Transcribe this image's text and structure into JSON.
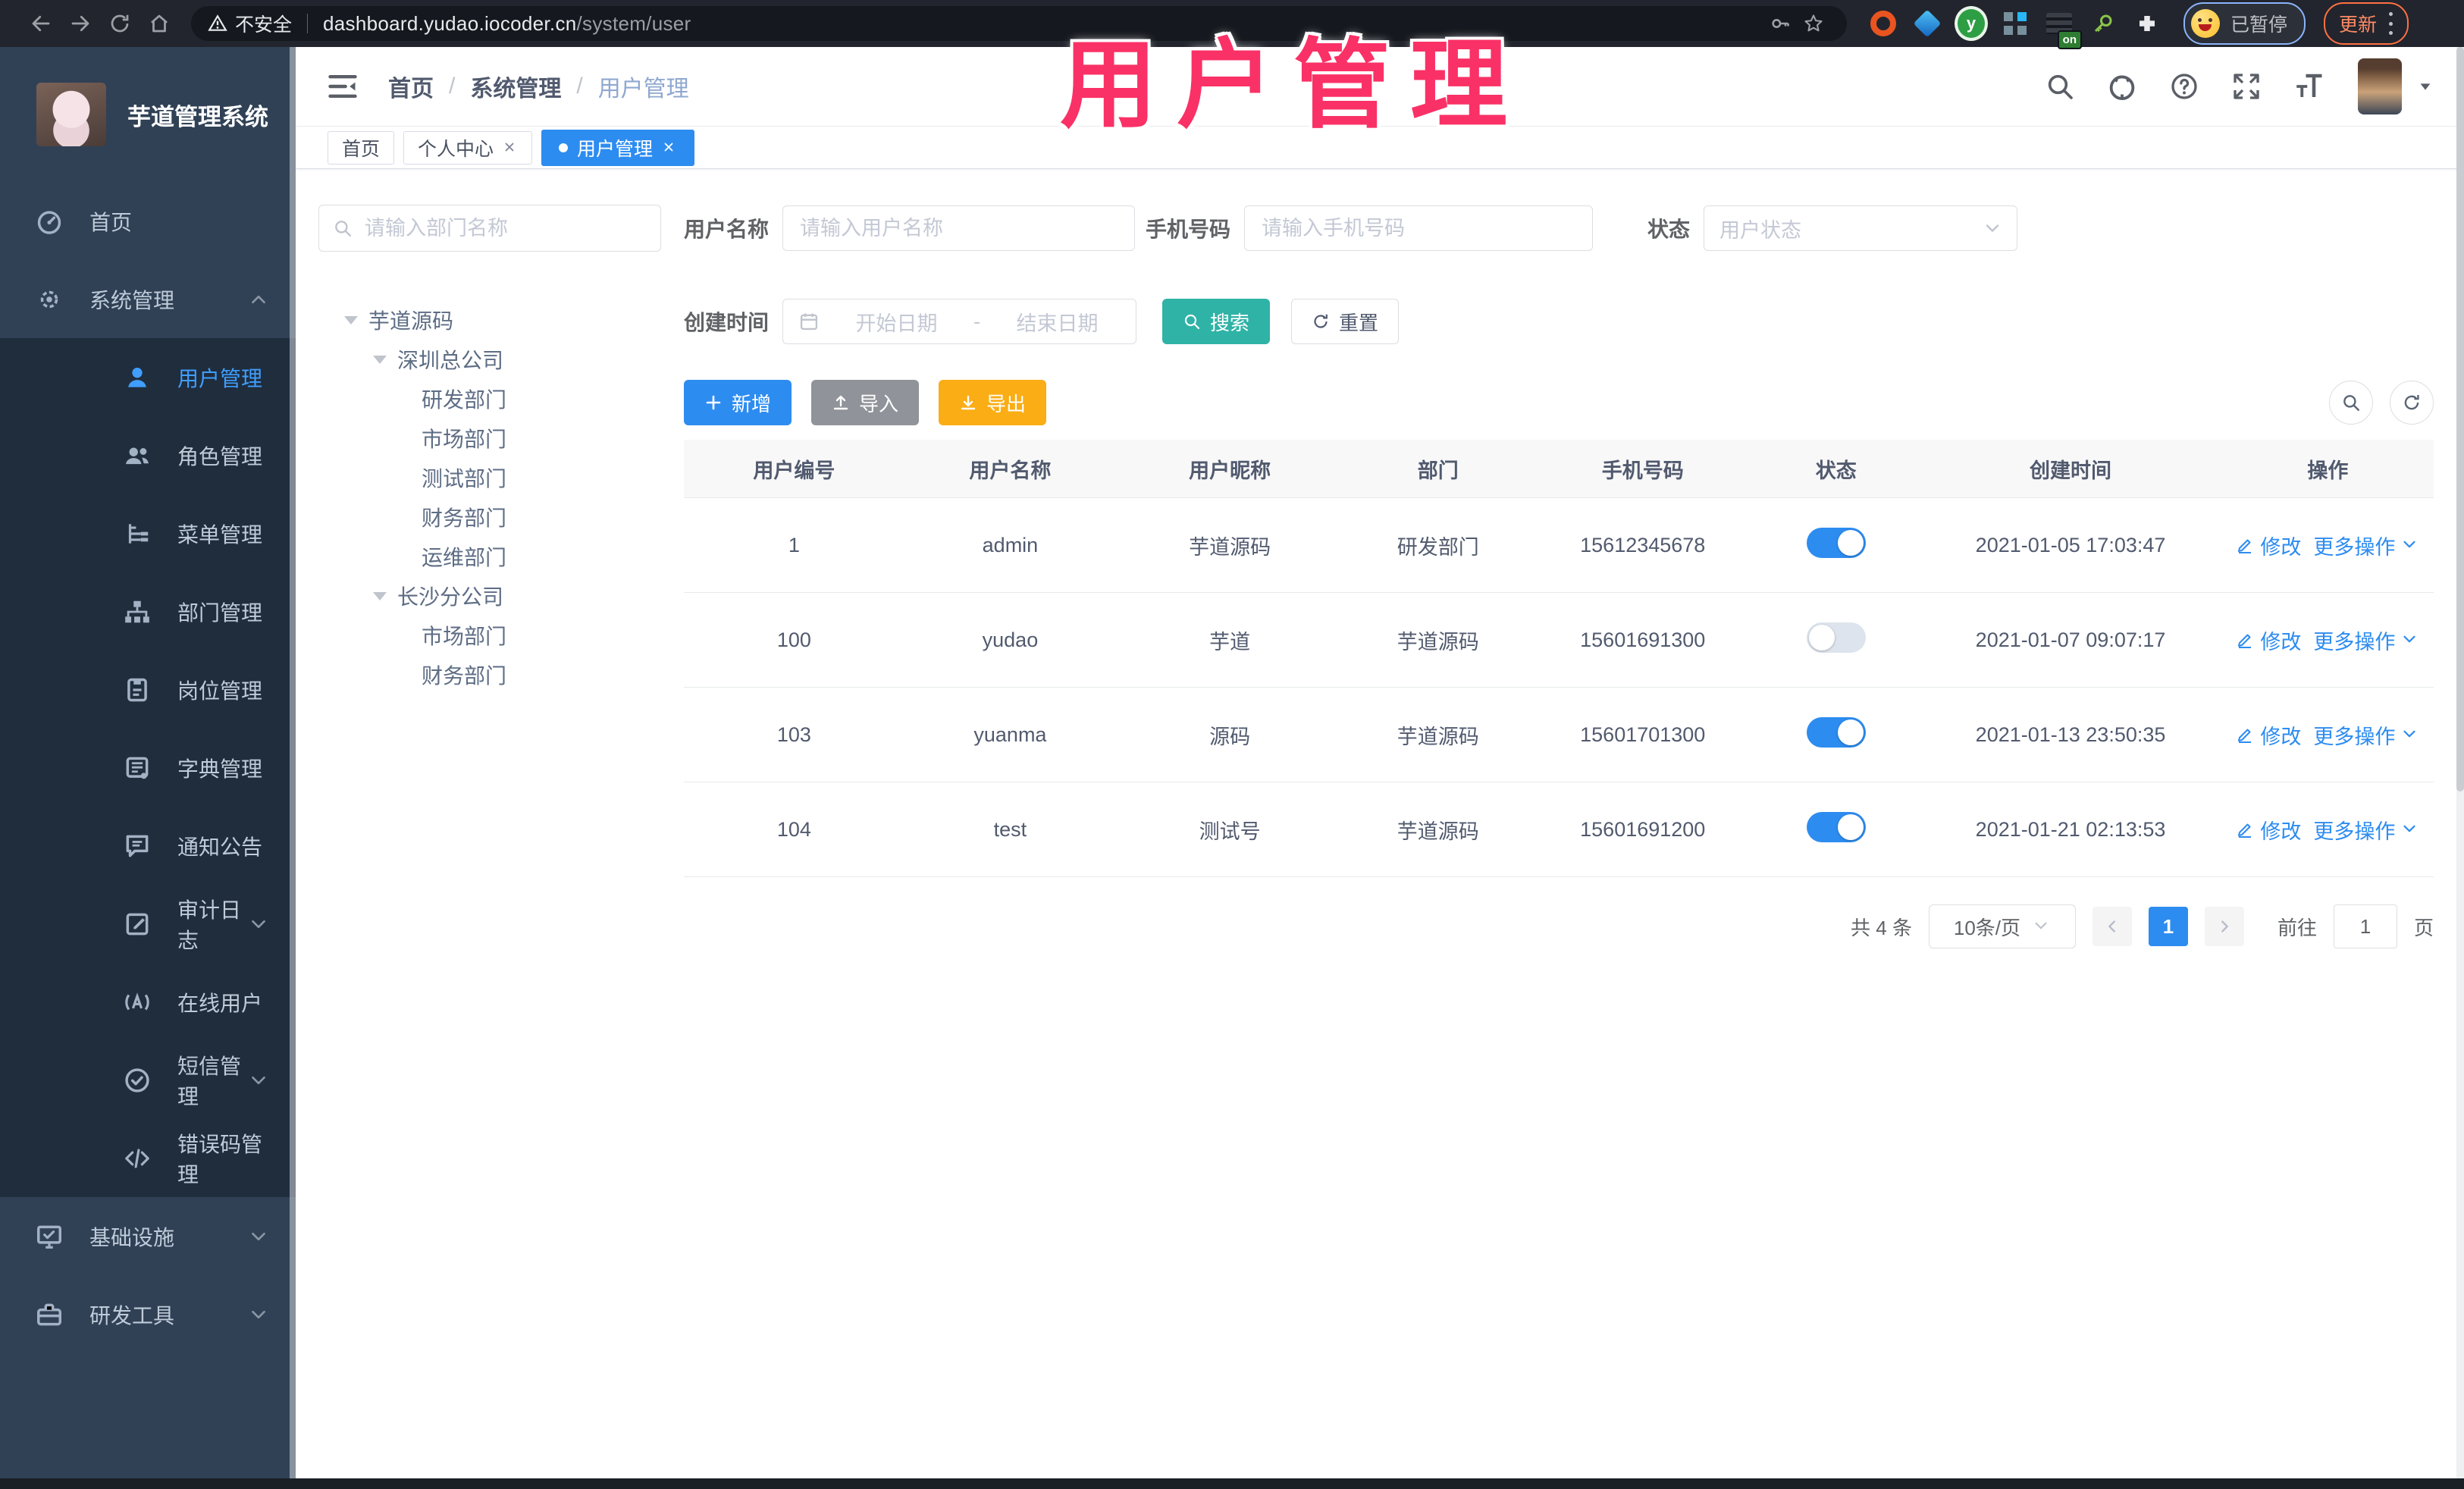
{
  "browser": {
    "security_label": "不安全",
    "url_host": "dashboard.yudao.iocoder.cn",
    "url_path": "/system/user",
    "profile_status": "已暂停",
    "update_label": "更新",
    "ext_y_letter": "y",
    "on_badge": "on"
  },
  "overlay_title": "用户管理",
  "sidebar": {
    "app_title": "芋道管理系统",
    "items": [
      {
        "label": "首页"
      },
      {
        "label": "系统管理"
      },
      {
        "label": "用户管理"
      },
      {
        "label": "角色管理"
      },
      {
        "label": "菜单管理"
      },
      {
        "label": "部门管理"
      },
      {
        "label": "岗位管理"
      },
      {
        "label": "字典管理"
      },
      {
        "label": "通知公告"
      },
      {
        "label": "审计日志"
      },
      {
        "label": "在线用户"
      },
      {
        "label": "短信管理"
      },
      {
        "label": "错误码管理"
      },
      {
        "label": "基础设施"
      },
      {
        "label": "研发工具"
      }
    ]
  },
  "header": {
    "breadcrumb": [
      "首页",
      "系统管理",
      "用户管理"
    ],
    "breadcrumb_sep": "/"
  },
  "tabs": [
    {
      "label": "首页"
    },
    {
      "label": "个人中心"
    },
    {
      "label": "用户管理"
    }
  ],
  "tree_panel": {
    "search_placeholder": "请输入部门名称",
    "nodes": [
      {
        "label": "芋道源码"
      },
      {
        "label": "深圳总公司"
      },
      {
        "label": "研发部门"
      },
      {
        "label": "市场部门"
      },
      {
        "label": "测试部门"
      },
      {
        "label": "财务部门"
      },
      {
        "label": "运维部门"
      },
      {
        "label": "长沙分公司"
      },
      {
        "label": "市场部门"
      },
      {
        "label": "财务部门"
      }
    ]
  },
  "filters": {
    "user_name_label": "用户名称",
    "user_name_placeholder": "请输入用户名称",
    "mobile_label": "手机号码",
    "mobile_placeholder": "请输入手机号码",
    "status_label": "状态",
    "status_placeholder": "用户状态",
    "create_time_label": "创建时间",
    "start_placeholder": "开始日期",
    "range_separator": "-",
    "end_placeholder": "结束日期",
    "search_label": "搜索",
    "reset_label": "重置"
  },
  "toolbar": {
    "add_label": "新增",
    "import_label": "导入",
    "export_label": "导出"
  },
  "table": {
    "columns": [
      "用户编号",
      "用户名称",
      "用户昵称",
      "部门",
      "手机号码",
      "状态",
      "创建时间",
      "操作"
    ],
    "action_edit": "修改",
    "action_more": "更多操作",
    "rows": [
      {
        "id": "1",
        "username": "admin",
        "nickname": "芋道源码",
        "dept": "研发部门",
        "mobile": "15612345678",
        "status": "on",
        "created": "2021-01-05 17:03:47"
      },
      {
        "id": "100",
        "username": "yudao",
        "nickname": "芋道",
        "dept": "芋道源码",
        "mobile": "15601691300",
        "status": "off",
        "created": "2021-01-07 09:07:17"
      },
      {
        "id": "103",
        "username": "yuanma",
        "nickname": "源码",
        "dept": "芋道源码",
        "mobile": "15601701300",
        "status": "on",
        "created": "2021-01-13 23:50:35"
      },
      {
        "id": "104",
        "username": "test",
        "nickname": "测试号",
        "dept": "芋道源码",
        "mobile": "15601691200",
        "status": "on",
        "created": "2021-01-21 02:13:53"
      }
    ]
  },
  "pagination": {
    "total_text": "共 4 条",
    "page_size_text": "10条/页",
    "current_page": "1",
    "goto_label": "前往",
    "goto_value": "1",
    "page_unit": "页"
  }
}
